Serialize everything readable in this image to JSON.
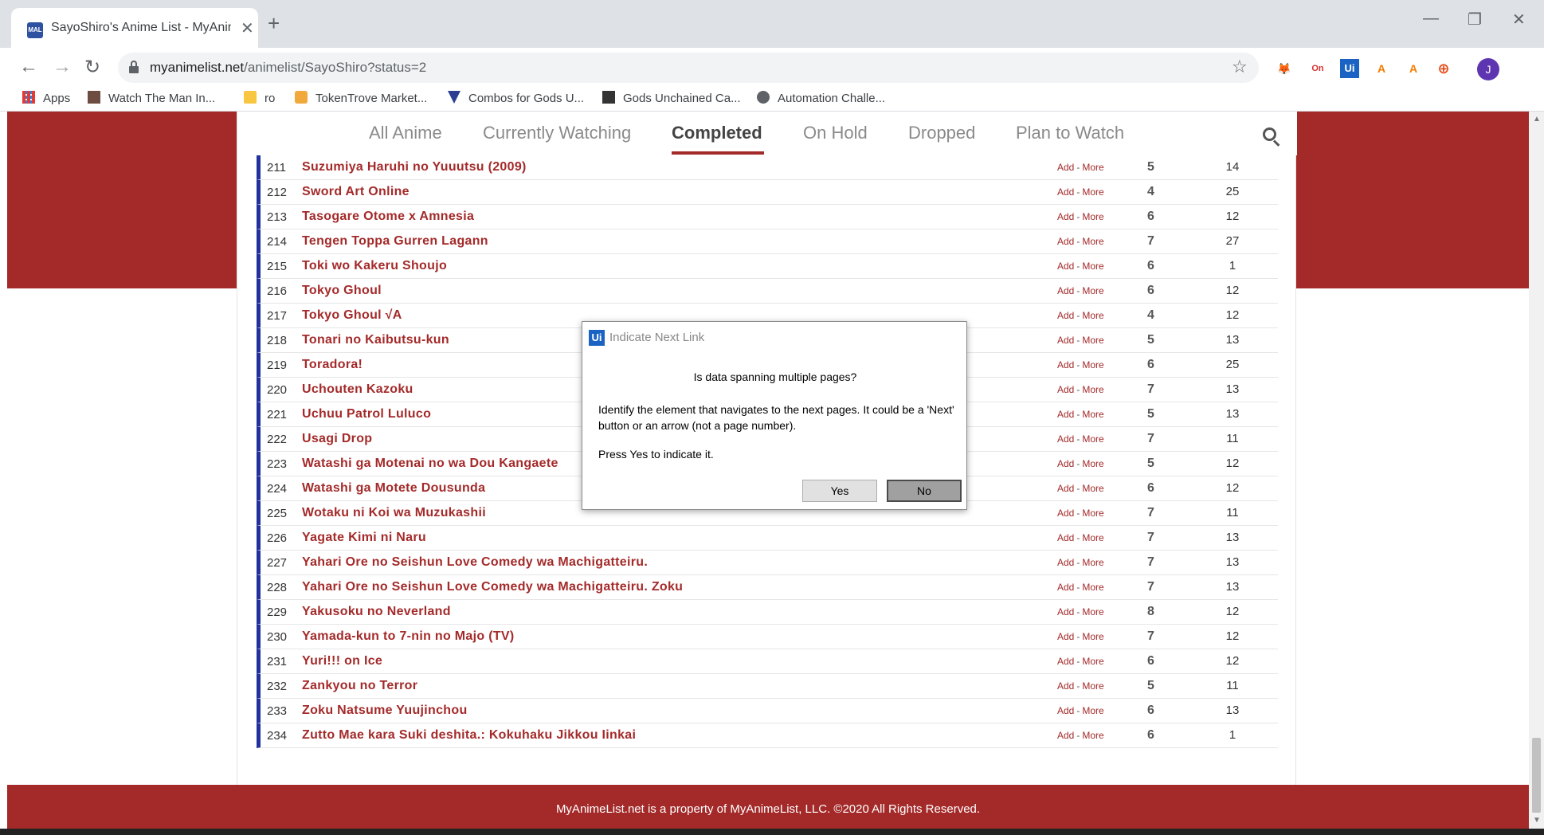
{
  "browser": {
    "tab_title": "SayoShiro's Anime List - MyAnim",
    "favicon_text": "MAL",
    "url_host": "myanimelist.net",
    "url_path": "/animelist/SayoShiro?status=2",
    "bookmarks": [
      {
        "label": "Apps",
        "icon": "apps-grid-icon"
      },
      {
        "label": "Watch The Man In...",
        "icon": "film-icon"
      },
      {
        "label": "ro",
        "icon": "folder-icon"
      },
      {
        "label": "TokenTrove Market...",
        "icon": "tokentrove-icon"
      },
      {
        "label": "Combos for Gods U...",
        "icon": "combos-icon"
      },
      {
        "label": "Gods Unchained Ca...",
        "icon": "gods-unchained-icon"
      },
      {
        "label": "Automation Challe...",
        "icon": "globe-icon"
      }
    ],
    "profile_initial": "J",
    "extensions": [
      "metamask-icon",
      "on-extension-icon",
      "uipath-icon",
      "acrobat-icon",
      "acrobat-icon",
      "download-icon"
    ]
  },
  "status_tabs": [
    "All Anime",
    "Currently Watching",
    "Completed",
    "On Hold",
    "Dropped",
    "Plan to Watch"
  ],
  "active_tab": "Completed",
  "row_links": {
    "add": "Add",
    "sep": "-",
    "more": "More"
  },
  "rows": [
    {
      "num": "211",
      "title": "Suzumiya Haruhi no Yuuutsu (2009)",
      "score": "5",
      "eps": "14"
    },
    {
      "num": "212",
      "title": "Sword Art Online",
      "score": "4",
      "eps": "25"
    },
    {
      "num": "213",
      "title": "Tasogare Otome x Amnesia",
      "score": "6",
      "eps": "12"
    },
    {
      "num": "214",
      "title": "Tengen Toppa Gurren Lagann",
      "score": "7",
      "eps": "27"
    },
    {
      "num": "215",
      "title": "Toki wo Kakeru Shoujo",
      "score": "6",
      "eps": "1"
    },
    {
      "num": "216",
      "title": "Tokyo Ghoul",
      "score": "6",
      "eps": "12"
    },
    {
      "num": "217",
      "title": "Tokyo Ghoul √A",
      "score": "4",
      "eps": "12"
    },
    {
      "num": "218",
      "title": "Tonari no Kaibutsu-kun",
      "score": "5",
      "eps": "13"
    },
    {
      "num": "219",
      "title": "Toradora!",
      "score": "6",
      "eps": "25"
    },
    {
      "num": "220",
      "title": "Uchouten Kazoku",
      "score": "7",
      "eps": "13"
    },
    {
      "num": "221",
      "title": "Uchuu Patrol Luluco",
      "score": "5",
      "eps": "13"
    },
    {
      "num": "222",
      "title": "Usagi Drop",
      "score": "7",
      "eps": "11"
    },
    {
      "num": "223",
      "title": "Watashi ga Motenai no wa Dou Kangaete",
      "score": "5",
      "eps": "12"
    },
    {
      "num": "224",
      "title": "Watashi ga Motete Dousunda",
      "score": "6",
      "eps": "12"
    },
    {
      "num": "225",
      "title": "Wotaku ni Koi wa Muzukashii",
      "score": "7",
      "eps": "11"
    },
    {
      "num": "226",
      "title": "Yagate Kimi ni Naru",
      "score": "7",
      "eps": "13"
    },
    {
      "num": "227",
      "title": "Yahari Ore no Seishun Love Comedy wa Machigatteiru.",
      "score": "7",
      "eps": "13"
    },
    {
      "num": "228",
      "title": "Yahari Ore no Seishun Love Comedy wa Machigatteiru. Zoku",
      "score": "7",
      "eps": "13"
    },
    {
      "num": "229",
      "title": "Yakusoku no Neverland",
      "score": "8",
      "eps": "12"
    },
    {
      "num": "230",
      "title": "Yamada-kun to 7-nin no Majo (TV)",
      "score": "7",
      "eps": "12"
    },
    {
      "num": "231",
      "title": "Yuri!!! on Ice",
      "score": "6",
      "eps": "12"
    },
    {
      "num": "232",
      "title": "Zankyou no Terror",
      "score": "5",
      "eps": "11"
    },
    {
      "num": "233",
      "title": "Zoku Natsume Yuujinchou",
      "score": "6",
      "eps": "13"
    },
    {
      "num": "234",
      "title": "Zutto Mae kara Suki deshita.: Kokuhaku Jikkou Iinkai",
      "score": "6",
      "eps": "1"
    }
  ],
  "footer": "MyAnimeList.net is a property of MyAnimeList, LLC. ©2020 All Rights Reserved.",
  "dialog": {
    "icon_text": "Ui",
    "title": "Indicate Next Link",
    "heading": "Is data spanning multiple pages?",
    "body": "Identify the element that navigates to the next pages. It could be a 'Next' button or an arrow (not a page number).",
    "note": "Press Yes to indicate it.",
    "yes": "Yes",
    "no": "No"
  },
  "colors": {
    "brand": "#a42a2a",
    "row_accent": "#22319e"
  }
}
